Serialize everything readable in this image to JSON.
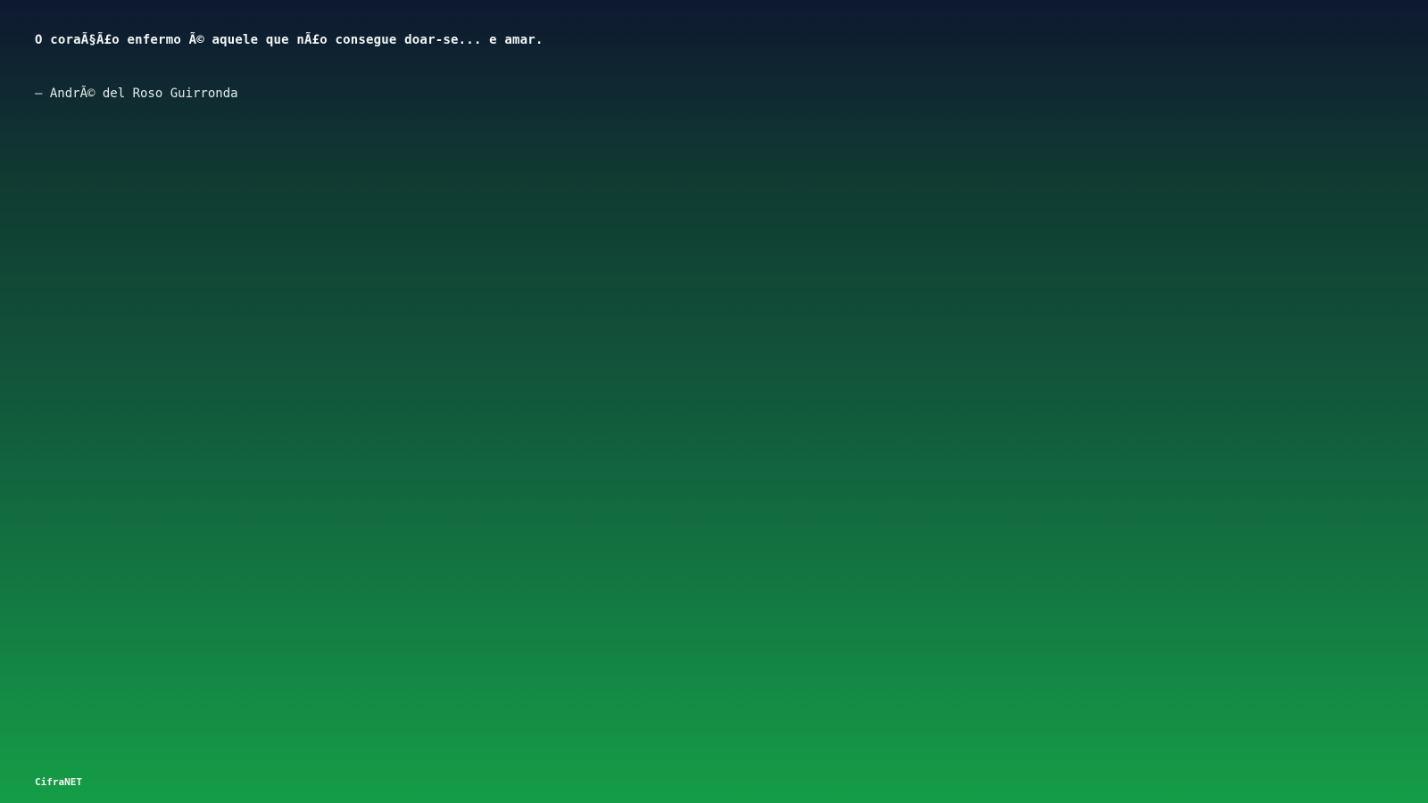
{
  "quote": {
    "text": "O coraÃ§Ã£o enfermo Ã© aquele que nÃ£o consegue doar-se... e amar.",
    "author": "– AndrÃ© del Roso Guirronda"
  },
  "footer": {
    "brand": "CifraNET"
  },
  "colors": {
    "gradient_top": "#0e1830",
    "gradient_bottom": "#159d47",
    "text": "#ffffff"
  }
}
